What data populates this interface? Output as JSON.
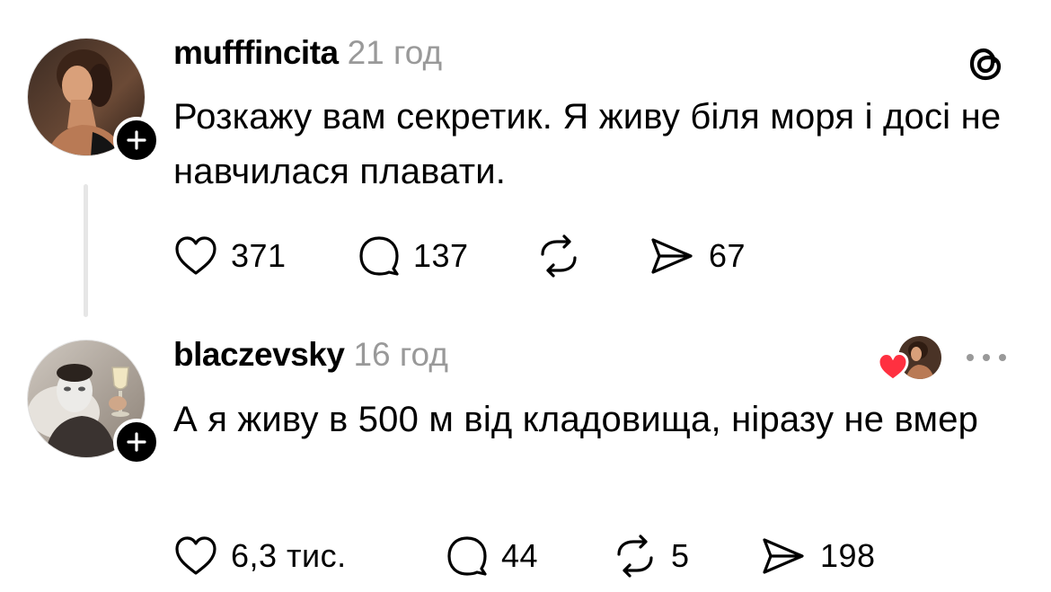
{
  "posts": [
    {
      "username": "mufffincita",
      "time": "21 год",
      "text": "Розкажу вам секретик. Я живу біля моря і досі не навчилася плавати.",
      "likes": "371",
      "replies": "137",
      "reposts": "",
      "shares": "67",
      "avatar": "woman-profile-photo"
    },
    {
      "username": "blaczevsky",
      "time": "16 год",
      "text": "А я живу в 500 м від кладовища, ніразу не вмер",
      "likes": "6,3 тис.",
      "replies": "44",
      "reposts": "5",
      "shares": "198",
      "avatar": "man-with-face-mask-photo"
    }
  ],
  "icons": {
    "like": "heart-icon",
    "reply": "comment-icon",
    "repost": "repost-icon",
    "share": "send-icon",
    "follow": "plus-icon",
    "app": "threads-logo-icon",
    "more": "more-dots-icon"
  },
  "colors": {
    "text": "#000000",
    "muted": "#999999",
    "thread_line": "#e6e6e6",
    "liked_heart": "#ff3040"
  }
}
